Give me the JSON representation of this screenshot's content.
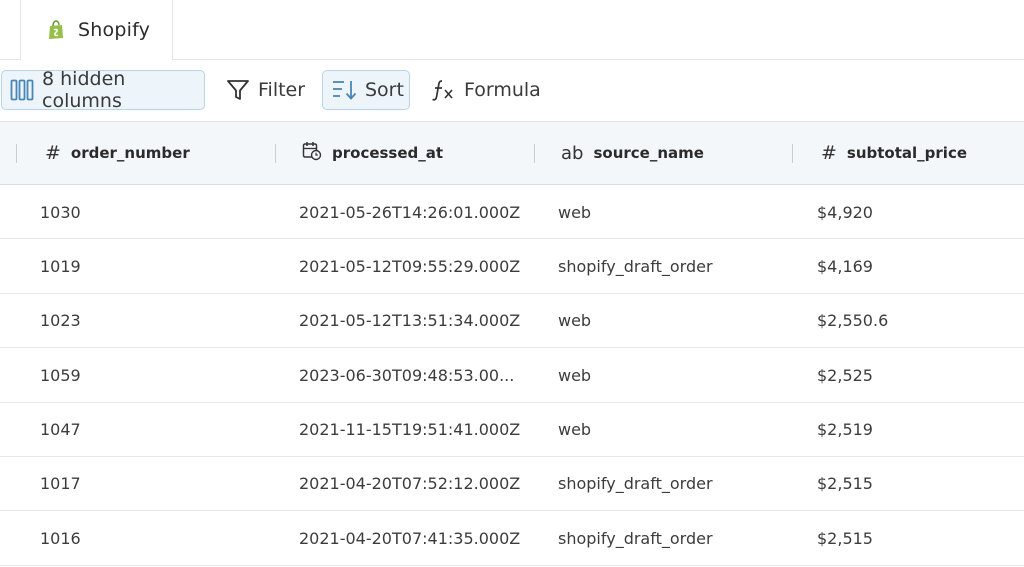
{
  "tab": {
    "label": "Shopify",
    "icon": "shopify-bag-icon",
    "icon_color": "#95bf47"
  },
  "toolbar": {
    "hidden_columns_label": "8 hidden columns",
    "filter_label": "Filter",
    "sort_label": "Sort",
    "formula_label": "Formula",
    "accent_color": "#4a86b5"
  },
  "columns": [
    {
      "name": "order_number",
      "type_icon": "#"
    },
    {
      "name": "processed_at",
      "type_icon": "calendar-clock-icon"
    },
    {
      "name": "source_name",
      "type_icon": "ab"
    },
    {
      "name": "subtotal_price",
      "type_icon": "#"
    }
  ],
  "rows": [
    [
      "1030",
      "2021-05-26T14:26:01.000Z",
      "web",
      "$4,920"
    ],
    [
      "1019",
      "2021-05-12T09:55:29.000Z",
      "shopify_draft_order",
      "$4,169"
    ],
    [
      "1023",
      "2021-05-12T13:51:34.000Z",
      "web",
      "$2,550.6"
    ],
    [
      "1059",
      "2023-06-30T09:48:53.00...",
      "web",
      "$2,525"
    ],
    [
      "1047",
      "2021-11-15T19:51:41.000Z",
      "web",
      "$2,519"
    ],
    [
      "1017",
      "2021-04-20T07:52:12.000Z",
      "shopify_draft_order",
      "$2,515"
    ],
    [
      "1016",
      "2021-04-20T07:41:35.000Z",
      "shopify_draft_order",
      "$2,515"
    ]
  ]
}
